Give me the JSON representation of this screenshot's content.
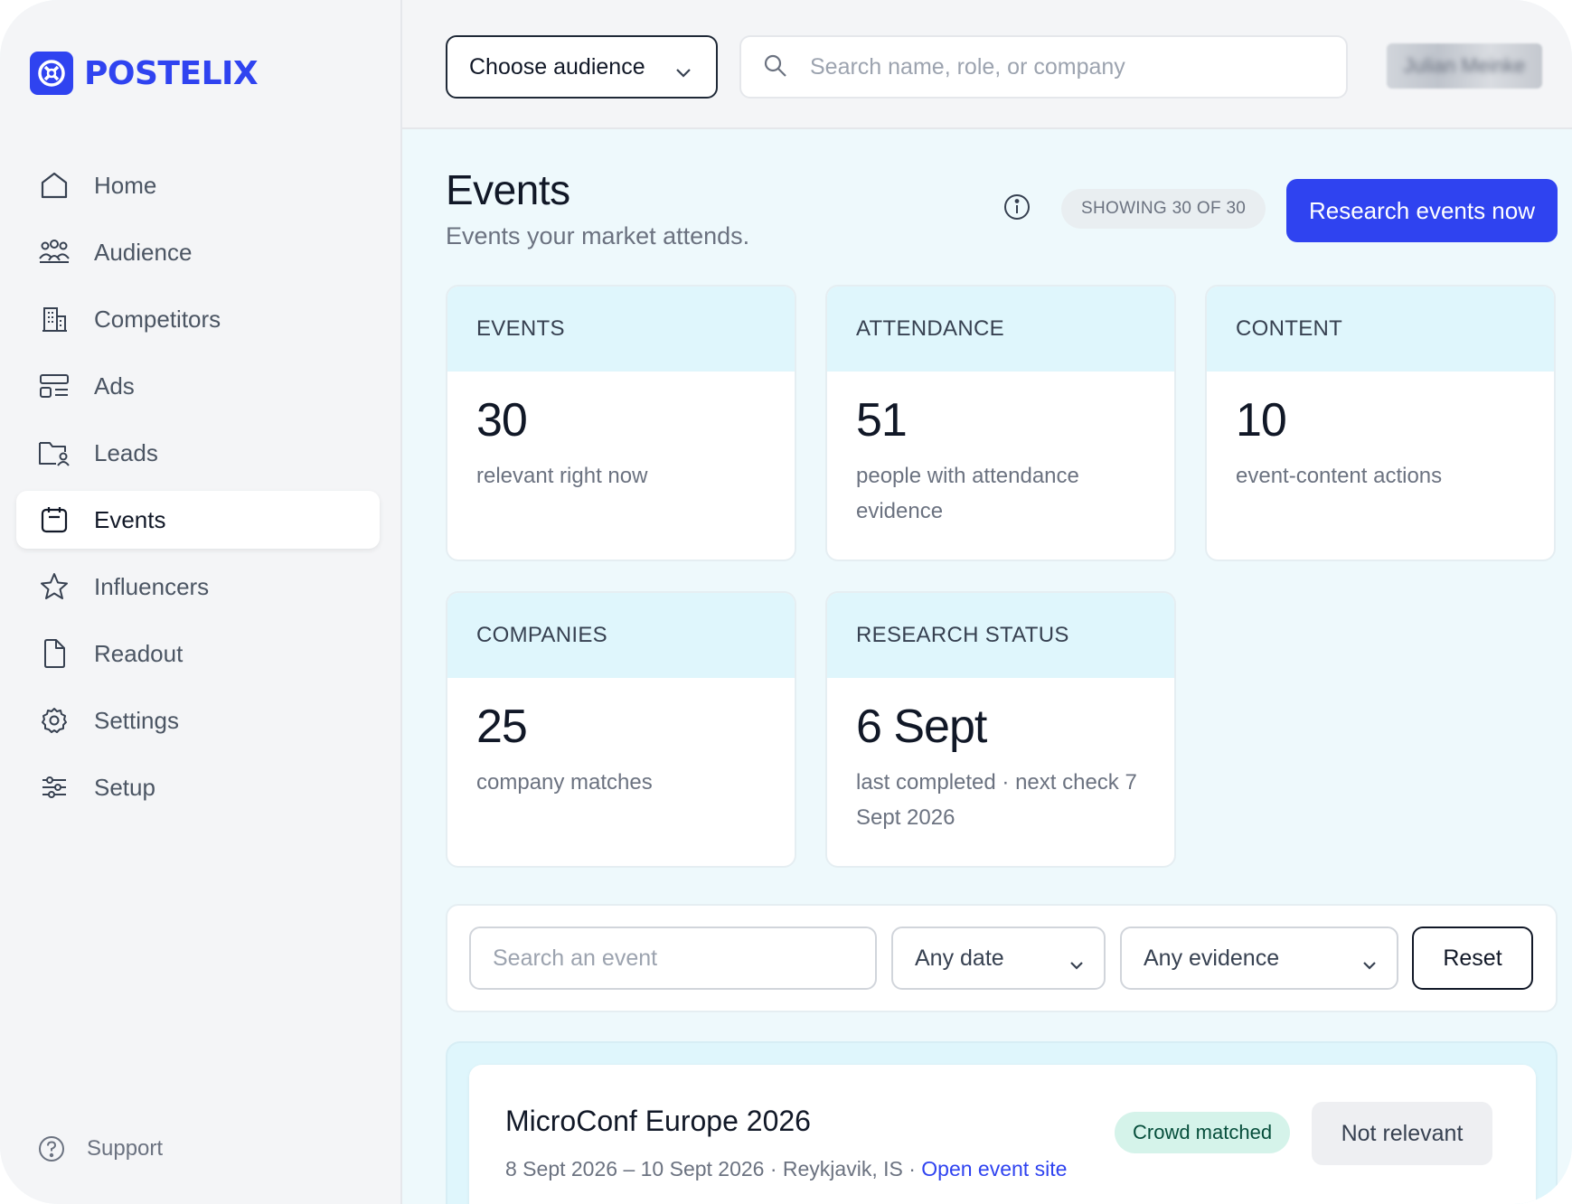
{
  "brand": {
    "name": "POSTELIX",
    "color": "#2f43f0"
  },
  "sidebar": {
    "items": [
      {
        "label": "Home",
        "icon": "home-icon"
      },
      {
        "label": "Audience",
        "icon": "people-icon"
      },
      {
        "label": "Competitors",
        "icon": "building-icon"
      },
      {
        "label": "Ads",
        "icon": "layout-icon"
      },
      {
        "label": "Leads",
        "icon": "folder-user-icon"
      },
      {
        "label": "Events",
        "icon": "calendar-icon",
        "active": true
      },
      {
        "label": "Influencers",
        "icon": "star-icon"
      },
      {
        "label": "Readout",
        "icon": "document-icon"
      },
      {
        "label": "Settings",
        "icon": "gear-icon"
      },
      {
        "label": "Setup",
        "icon": "sliders-icon"
      }
    ],
    "support_label": "Support"
  },
  "topbar": {
    "audience_select": "Choose audience",
    "search_placeholder": "Search name, role, or company",
    "user_name": "Julian Meinke"
  },
  "page": {
    "title": "Events",
    "subtitle": "Events your market attends.",
    "showing_badge": "SHOWING 30 OF 30",
    "research_button": "Research events now"
  },
  "stats": [
    {
      "label": "EVENTS",
      "value": "30",
      "desc": "relevant right now"
    },
    {
      "label": "ATTENDANCE",
      "value": "51",
      "desc": "people with attendance evidence"
    },
    {
      "label": "CONTENT",
      "value": "10",
      "desc": "event-content actions"
    },
    {
      "label": "COMPANIES",
      "value": "25",
      "desc": "company matches"
    },
    {
      "label": "RESEARCH STATUS",
      "value": "6 Sept",
      "desc": "last completed · next check 7 Sept 2026"
    }
  ],
  "filters": {
    "search_placeholder": "Search an event",
    "date_select": "Any date",
    "evidence_select": "Any evidence",
    "reset_label": "Reset"
  },
  "events": [
    {
      "title": "MicroConf Europe 2026",
      "dates": "8 Sept 2026 – 10 Sept 2026 · Reykjavik, IS · ",
      "link": "Open event site",
      "badge": "Crowd matched",
      "action": "Not relevant"
    }
  ]
}
